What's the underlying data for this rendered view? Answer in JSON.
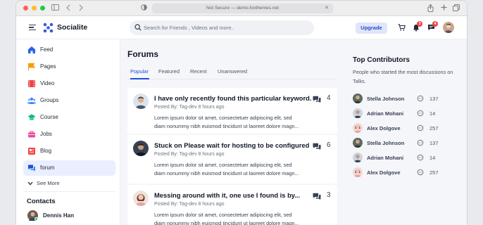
{
  "browser": {
    "url_text": "Not Secure — demo.foxthemes.net"
  },
  "header": {
    "brand": "Socialite",
    "search_placeholder": "Search for Friends , Videos and more..",
    "upgrade_label": "Upgrade",
    "notifications_count": "3",
    "messages_count": "4"
  },
  "sidebar": {
    "items": [
      {
        "label": "Feed",
        "icon": "home-icon"
      },
      {
        "label": "Pages",
        "icon": "flag-icon"
      },
      {
        "label": "Video",
        "icon": "film-icon"
      },
      {
        "label": "Groups",
        "icon": "groups-icon"
      },
      {
        "label": "Course",
        "icon": "graduation-cap-icon"
      },
      {
        "label": "Jobs",
        "icon": "briefcase-icon"
      },
      {
        "label": "Blog",
        "icon": "blog-icon"
      },
      {
        "label": "forum",
        "icon": "chat-icon"
      }
    ],
    "see_more": "See More",
    "contacts_title": "Contacts",
    "contacts": [
      {
        "name": "Dennis Han"
      }
    ]
  },
  "main": {
    "title": "Forums",
    "tabs": [
      {
        "label": "Popular",
        "active": true
      },
      {
        "label": "Featured",
        "active": false
      },
      {
        "label": "Recent",
        "active": false
      },
      {
        "label": "Unanswered",
        "active": false
      }
    ],
    "threads": [
      {
        "title": "I have only recently found this particular keyword.",
        "meta": "Posted By: Tag-dev 8 hours ago",
        "body_line1": "Lorem ipsum dolor sit amet, consectetuer adipiscing elit, sed",
        "body_line2": "diam nonummy nibh euismod tincidunt ut laoreet dolore magn...",
        "comments": "4"
      },
      {
        "title": "Stuck on Please wait for hosting to be configured",
        "meta": "Posted By: Tag-dev 8 hours ago",
        "body_line1": "Lorem ipsum dolor sit amet, consectetuer adipiscing elit, sed",
        "body_line2": "diam nonummy nibh euismod tincidunt ut laoreet dolore magn...",
        "comments": "6"
      },
      {
        "title": "Messing around with it, one use I found is by...",
        "meta": "Posted By: Tag-dev 8 hours ago",
        "body_line1": "Lorem ipsum dolor sit amet, consectetuer adipiscing elit, sed",
        "body_line2": "diam nonummy nibh euismod tincidunt ut laoreet dolore magn...",
        "comments": "3"
      }
    ]
  },
  "contributors": {
    "title": "Top Contributors",
    "description": "People who started the most discussions on Talks.",
    "list": [
      {
        "name": "Stella Johnson",
        "count": "137"
      },
      {
        "name": "Adrian Mohani",
        "count": "14"
      },
      {
        "name": "Alex Dolgove",
        "count": "257"
      },
      {
        "name": "Stella Johnson",
        "count": "137"
      },
      {
        "name": "Adrian Mohani",
        "count": "14"
      },
      {
        "name": "Alex Dolgove",
        "count": "257"
      }
    ]
  },
  "colors": {
    "accent": "#1d4ed8",
    "upgrade_bg": "#dfe6fb",
    "badge": "#ef4444",
    "active_bg": "#eaefff"
  }
}
